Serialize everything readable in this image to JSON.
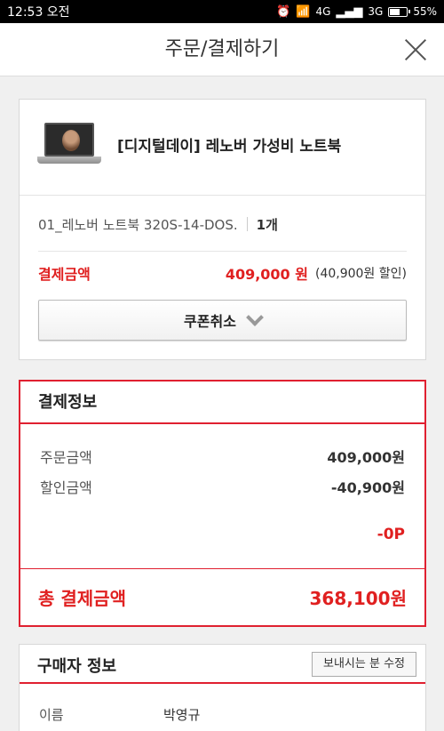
{
  "status_bar": {
    "time": "12:53 오전",
    "network1": "4G",
    "network2": "3G",
    "battery_text": "55%",
    "battery_level": 0.55
  },
  "header": {
    "title": "주문/결제하기",
    "close_icon": "close-icon"
  },
  "product": {
    "name": "[디지털데이] 레노버 가성비 노트북",
    "option": "01_레노버 노트북 320S-14-DOS.",
    "quantity": "1개",
    "pay_label": "결제금액",
    "pay_amount": "409,000 원",
    "discount_note": "(40,900원 할인)",
    "coupon_button": "쿠폰취소"
  },
  "payment_info": {
    "title": "결제정보",
    "order_amount_label": "주문금액",
    "order_amount": "409,000원",
    "discount_label": "할인금액",
    "discount_amount": "-40,900원",
    "point_amount": "-0P",
    "total_label": "총 결제금액",
    "total_amount": "368,100원"
  },
  "buyer_info": {
    "title": "구매자 정보",
    "edit_button": "보내시는 분 수정",
    "name_label": "이름",
    "name_value": "박영규"
  },
  "colors": {
    "accent": "#e02020",
    "border_accent": "#e02030"
  }
}
